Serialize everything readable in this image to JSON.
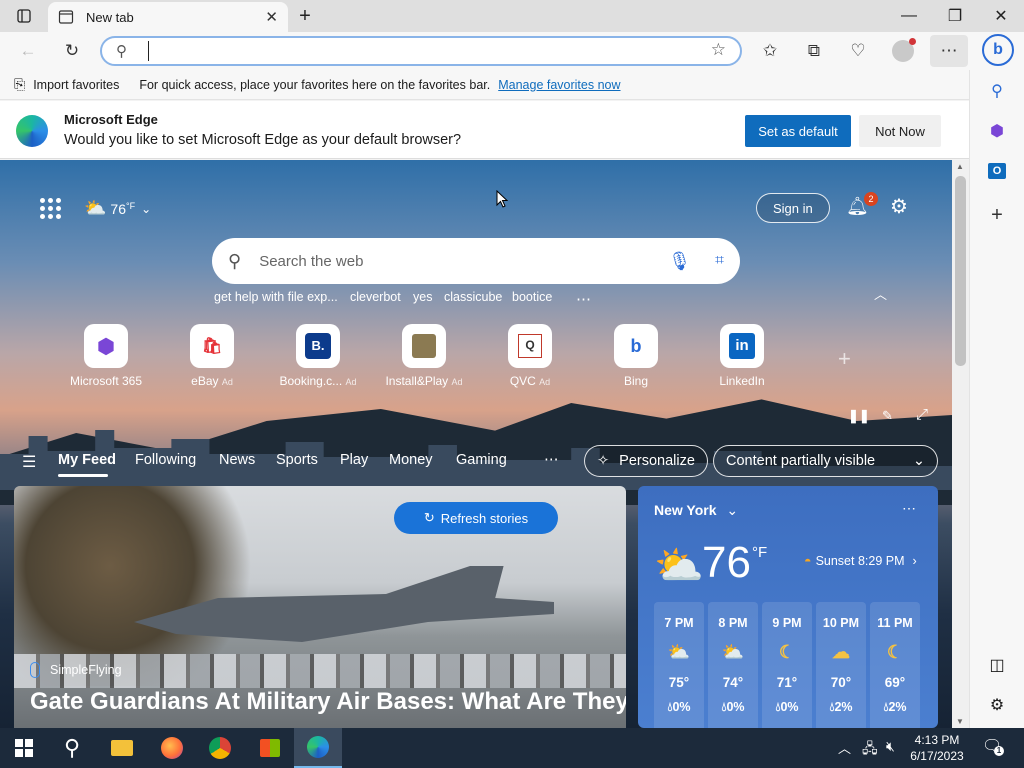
{
  "browser": {
    "tab_title": "New tab",
    "address_value": ""
  },
  "favorites_bar": {
    "import_label": "Import favorites",
    "hint": "For quick access, place your favorites here on the favorites bar.",
    "manage_link": "Manage favorites now"
  },
  "default_prompt": {
    "title": "Microsoft Edge",
    "message": "Would you like to set Microsoft Edge as your default browser?",
    "set_default_label": "Set as default",
    "not_now_label": "Not Now"
  },
  "newtab": {
    "weather_temp": "76",
    "weather_unit": "°F",
    "sign_in_label": "Sign in",
    "notification_count": "2",
    "search_placeholder": "Search the web",
    "suggestions": [
      "get help with file exp...",
      "cleverbot",
      "yes",
      "classicube",
      "bootice"
    ],
    "quick_links": [
      {
        "label": "Microsoft 365",
        "ad": ""
      },
      {
        "label": "eBay",
        "ad": "Ad"
      },
      {
        "label": "Booking.c...",
        "ad": "Ad"
      },
      {
        "label": "Install&Play",
        "ad": "Ad"
      },
      {
        "label": "QVC",
        "ad": "Ad"
      },
      {
        "label": "Bing",
        "ad": ""
      },
      {
        "label": "LinkedIn",
        "ad": ""
      }
    ],
    "feed_tabs": [
      "My Feed",
      "Following",
      "News",
      "Sports",
      "Play",
      "Money",
      "Gaming"
    ],
    "personalize_label": "Personalize",
    "content_visibility": "Content partially visible",
    "refresh_label": "Refresh stories",
    "story_source": "SimpleFlying",
    "story_headline": "Gate Guardians At Military Air Bases: What Are They"
  },
  "weather_card": {
    "city": "New York",
    "temp": "76",
    "unit": "°F",
    "sunset": "Sunset 8:29 PM",
    "hourly": [
      {
        "time": "7 PM",
        "temp": "75°",
        "precip": "0%"
      },
      {
        "time": "8 PM",
        "temp": "74°",
        "precip": "0%"
      },
      {
        "time": "9 PM",
        "temp": "71°",
        "precip": "0%"
      },
      {
        "time": "10 PM",
        "temp": "70°",
        "precip": "2%"
      },
      {
        "time": "11 PM",
        "temp": "69°",
        "precip": "2%"
      }
    ]
  },
  "taskbar": {
    "time": "4:13 PM",
    "date": "6/17/2023"
  },
  "colors": {
    "accent": "#0f6cbd",
    "taskbar": "#1c2a3b"
  }
}
